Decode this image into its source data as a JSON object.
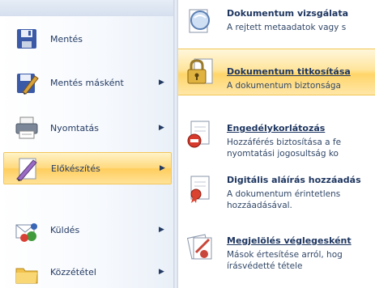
{
  "left_menu": {
    "items": [
      {
        "label": "Mentés",
        "has_submenu": false
      },
      {
        "label": "Mentés másként",
        "has_submenu": true
      },
      {
        "label": "Nyomtatás",
        "has_submenu": true
      },
      {
        "label": "Előkészítés",
        "has_submenu": true,
        "selected": true
      },
      {
        "label": "Küldés",
        "has_submenu": true
      },
      {
        "label": "Közzététel",
        "has_submenu": true
      }
    ],
    "arrow_glyph": "▶"
  },
  "right_menu": {
    "items": [
      {
        "title": "Dokumentum vizsgálata",
        "desc_lines": [
          "A rejtett metaadatok vagy s"
        ],
        "icon": "inspect-document-icon"
      },
      {
        "title": "Dokumentum titkosítása",
        "desc_lines": [
          "A dokumentum biztonsága"
        ],
        "icon": "encrypt-document-icon",
        "highlighted": true
      },
      {
        "title": "Engedélykorlátozás",
        "desc_lines": [
          "Hozzáférés biztosítása a fe",
          "nyomtatási jogosultság ko"
        ],
        "icon": "restrict-permission-icon"
      },
      {
        "title": "Digitális aláírás hozzáadás",
        "desc_lines": [
          "A dokumentum érintetlens",
          "hozzáadásával."
        ],
        "icon": "digital-signature-icon"
      },
      {
        "title": "Megjelölés véglegesként",
        "desc_lines": [
          "Mások értesítése arról, hog",
          "írásvédetté tétele"
        ],
        "icon": "mark-as-final-icon"
      }
    ]
  },
  "colors": {
    "text": "#233a63",
    "highlight": "#ffd56a",
    "highlight_border": "#f1c552"
  }
}
